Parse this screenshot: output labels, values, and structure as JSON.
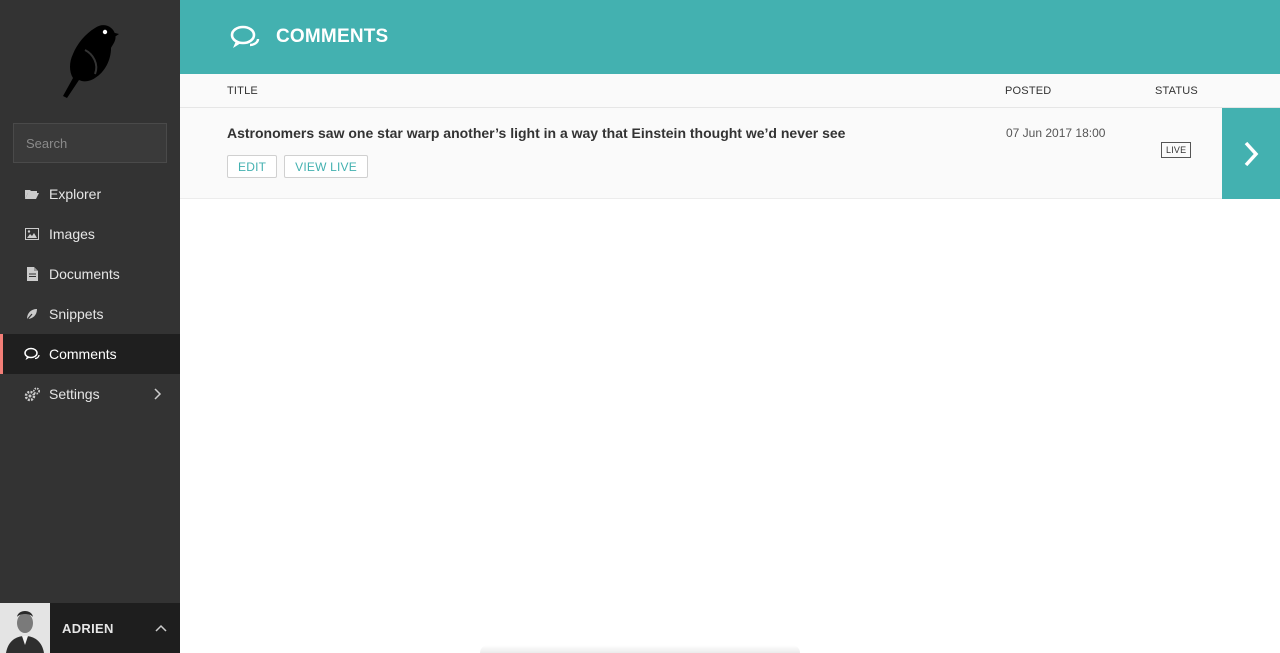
{
  "brand": {
    "logo_icon": "bird-logo-icon"
  },
  "search": {
    "placeholder": "Search",
    "icon": "search-icon"
  },
  "nav": {
    "items": [
      {
        "label": "Explorer",
        "icon": "folder-open-icon"
      },
      {
        "label": "Images",
        "icon": "image-icon"
      },
      {
        "label": "Documents",
        "icon": "document-icon"
      },
      {
        "label": "Snippets",
        "icon": "snippets-icon"
      },
      {
        "label": "Comments",
        "icon": "comments-icon",
        "active": true
      },
      {
        "label": "Settings",
        "icon": "cogs-icon",
        "has_submenu": true
      }
    ]
  },
  "account": {
    "name": "ADRIEN"
  },
  "header": {
    "title": "COMMENTS",
    "icon": "comments-icon"
  },
  "table": {
    "columns": {
      "title": "TITLE",
      "posted": "POSTED",
      "status": "STATUS"
    },
    "rows": [
      {
        "title": "Astronomers saw one star warp another’s light in a way that Einstein thought we’d never see",
        "edit_label": "EDIT",
        "view_live_label": "VIEW LIVE",
        "posted": "07 Jun 2017 18:00",
        "status": "LIVE"
      }
    ]
  },
  "colors": {
    "accent": "#43b1b0",
    "sidebar": "#333333",
    "active_marker": "#f37e77"
  }
}
